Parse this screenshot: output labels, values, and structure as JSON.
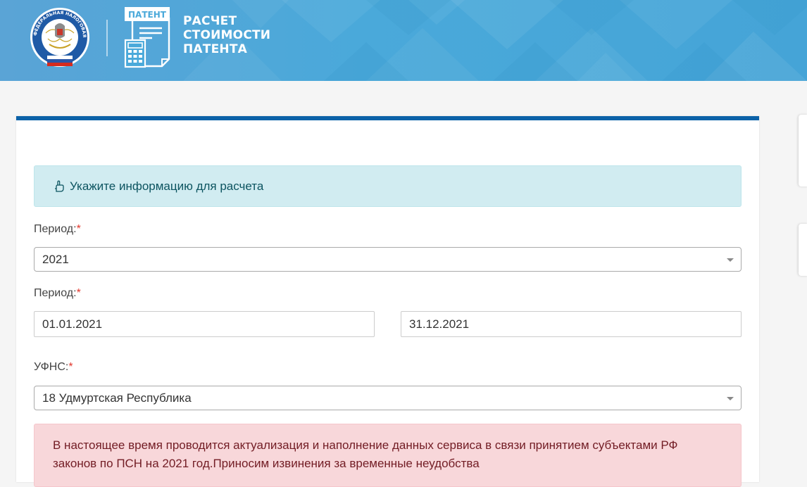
{
  "header": {
    "patent_label": "ПАТЕНТ",
    "title_line1": "РАСЧЕТ",
    "title_line2": "СТОИМОСТИ",
    "title_line3": "ПАТЕНТА",
    "logo_ring_text": "ФЕДЕРАЛЬНАЯ НАЛОГОВАЯ СЛУЖБА"
  },
  "form": {
    "info_message": "Укажите информацию для расчета",
    "period_year_label": "Период:",
    "period_year_value": "2021",
    "period_range_label": "Период:",
    "date_from": "01.01.2021",
    "date_to": "31.12.2021",
    "ufns_label": "УФНС:",
    "ufns_value": "18 Удмуртская Республика",
    "required_mark": "*",
    "warning_message": "В настоящее время проводится актуализация и наполнение данных сервиса в связи принятием субъектами РФ законов по ПСН на 2021 год.Приносим извинения за временные неудобства"
  },
  "colors": {
    "header_blue": "#4aa9da",
    "card_top_border": "#0b62a8",
    "info_bg": "#d1ecf1",
    "danger_bg": "#f8d7da",
    "required": "#e2382e"
  },
  "icons": {
    "fns_logo": "fns-emblem-icon",
    "patent": "patent-calculator-icon",
    "info": "hand-pointing-icon",
    "dropdown": "chevron-down-icon"
  }
}
